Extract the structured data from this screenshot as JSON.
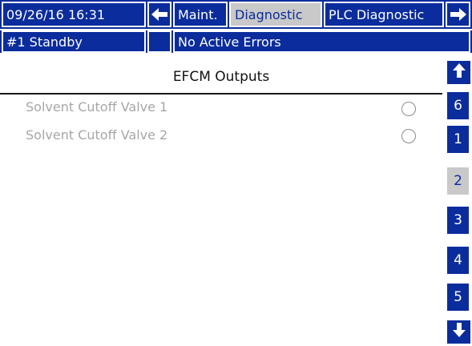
{
  "header": {
    "datetime": "09/26/16 16:31",
    "tabs": [
      {
        "label": "Maint.",
        "selected": false
      },
      {
        "label": "Diagnostic",
        "selected": true
      },
      {
        "label": "PLC Diagnostic",
        "selected": false
      }
    ],
    "status": "#1 Standby",
    "errors": "No Active Errors"
  },
  "page": {
    "title": "EFCM Outputs",
    "rows": [
      {
        "label": "Solvent Cutoff Valve 1",
        "state": "off"
      },
      {
        "label": "Solvent Cutoff Valve 2",
        "state": "off"
      }
    ]
  },
  "side_nav": {
    "buttons": [
      "6",
      "1",
      "2",
      "3",
      "4",
      "5"
    ],
    "selected": "2"
  },
  "icons": {
    "prev_tab": "arrow-left-icon",
    "next_tab": "arrow-right-icon",
    "page_up": "arrow-up-icon",
    "page_down": "arrow-down-icon",
    "output_indicator": "radio-indicator-icon"
  },
  "colors": {
    "bar_blue": "#0a2c9c",
    "selected_bg": "#c9c9c9",
    "disabled_text": "#a6a6a6"
  }
}
